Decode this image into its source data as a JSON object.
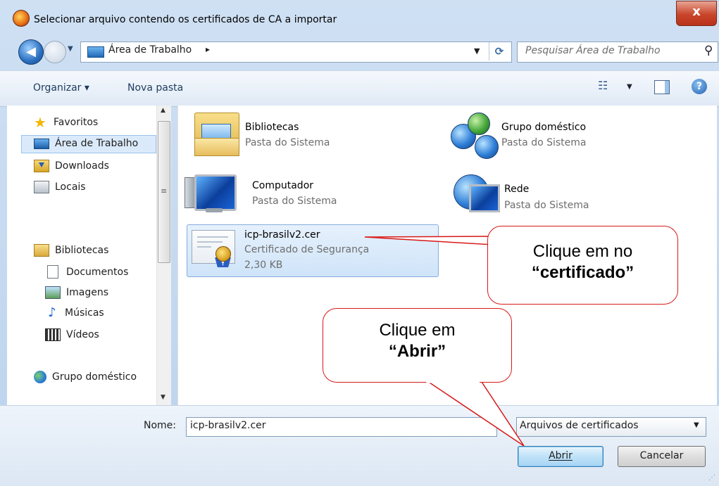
{
  "window": {
    "title": "Selecionar arquivo contendo os certificados de CA a importar",
    "close_label": "x"
  },
  "address": {
    "location": "Área de Trabalho",
    "separator": "▸",
    "search_placeholder": "Pesquisar Área de Trabalho"
  },
  "toolbar": {
    "organize_label": "Organizar ▾",
    "new_folder_label": "Nova pasta"
  },
  "sidebar": {
    "items": [
      {
        "label": "Favoritos",
        "icon": "star-icon"
      },
      {
        "label": "Área de Trabalho",
        "icon": "desktop-icon",
        "selected": true
      },
      {
        "label": "Downloads",
        "icon": "downloads-icon"
      },
      {
        "label": "Locais",
        "icon": "recent-places-icon"
      },
      {
        "label": "Bibliotecas",
        "icon": "libraries-icon"
      },
      {
        "label": "Documentos",
        "icon": "documents-icon"
      },
      {
        "label": "Imagens",
        "icon": "pictures-icon"
      },
      {
        "label": "Músicas",
        "icon": "music-icon"
      },
      {
        "label": "Vídeos",
        "icon": "videos-icon"
      },
      {
        "label": "Grupo doméstico",
        "icon": "homegroup-icon"
      }
    ]
  },
  "files": [
    {
      "name": "Bibliotecas",
      "sub": "Pasta do Sistema",
      "icon": "libraries-folder-icon"
    },
    {
      "name": "Grupo doméstico",
      "sub": "Pasta do Sistema",
      "icon": "homegroup-icon"
    },
    {
      "name": "Computador",
      "sub": "Pasta do Sistema",
      "icon": "computer-icon"
    },
    {
      "name": "Rede",
      "sub": "Pasta do Sistema",
      "icon": "network-icon"
    },
    {
      "name": "icp-brasilv2.cer",
      "sub": "Certificado de Segurança",
      "size": "2,30 KB",
      "icon": "certificate-icon",
      "selected": true
    }
  ],
  "bottom": {
    "name_label": "Nome:",
    "name_value": "icp-brasilv2.cer",
    "filetype_value": "Arquivos de certificados",
    "open_label": "Abrir",
    "cancel_label": "Cancelar"
  },
  "callouts": {
    "certificate": {
      "line1": "Clique em no",
      "line2": "“certificado”"
    },
    "open": {
      "line1": "Clique em",
      "line2": "“Abrir”"
    }
  },
  "colors": {
    "callout_border": "#d81818",
    "selection": "#cfe4f9",
    "accent": "#2a6fc0"
  }
}
